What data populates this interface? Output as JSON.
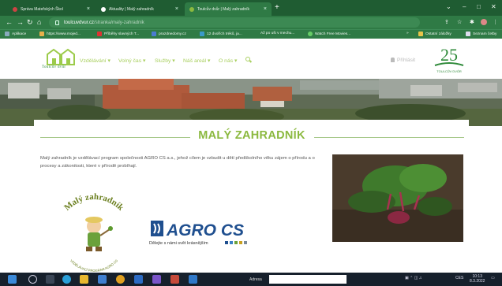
{
  "browser": {
    "tabs": [
      {
        "title": "Správa Mateřských Škol",
        "active": false
      },
      {
        "title": "Aktuality | Malý zahradník",
        "active": false
      },
      {
        "title": "Toulcův dvůr | Malý zahradník",
        "active": true
      }
    ],
    "url_host": "toulcuvdvur.cz",
    "url_path": "/stranka/maly-zahradnik",
    "bookmarks": [
      "Aplikace",
      "https://www.mojed...",
      "Příběhy slavných T...",
      "prazdnedomy.cz",
      "12 dvořích tréků, ja...",
      "Až po uši v mechu...",
      "Watch Free Movies...",
      "Ostatní záložky",
      "Seznam četby"
    ]
  },
  "site": {
    "logo_text": "Toulcův dvůr",
    "anniversary_number": "25",
    "anniversary_text": "TOULCŮV DVŮR",
    "nav": [
      "Vzdělávání",
      "Volný čas",
      "Služby",
      "Náš areál",
      "O nás"
    ],
    "login_label": "Přihlásit"
  },
  "page": {
    "title": "MALÝ ZAHRADNÍK",
    "description": "Malý zahradník je vzdělávací program společnosti AGRO CS a.s., jehož cílem je vzbudit u dětí předškolního věku zájem o přírodu a o procesy a zákonitosti, které v přírodě probíhají."
  },
  "mz_logo": {
    "top_text": "Malý zahradník",
    "bottom_text": "VZDĚLÁVACÍ PROGRAM AGRO CS"
  },
  "agro": {
    "name": "AGRO CS",
    "slogan": "Dělejte s námi svět krásnějším"
  },
  "taskbar": {
    "search_label": "Adresa",
    "lang": "CES",
    "time": "10:13",
    "date": "8.3.2022"
  },
  "colors": {
    "browser_green": "#2f7a45",
    "site_green": "#8bb93f",
    "agro_blue": "#1f4f8f"
  }
}
